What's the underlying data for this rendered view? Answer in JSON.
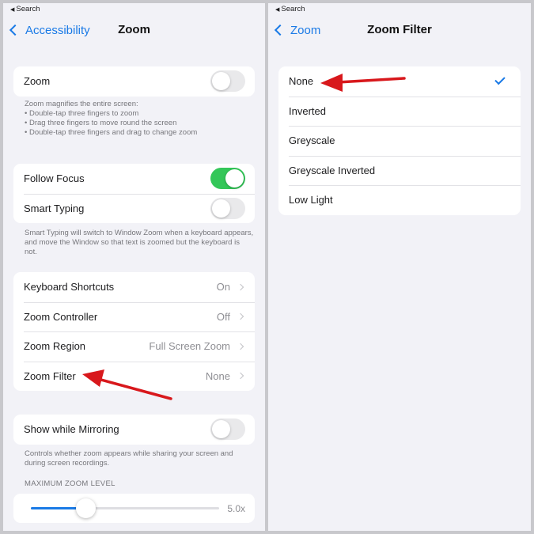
{
  "left": {
    "status": "Search",
    "back_label": "Accessibility",
    "title": "Zoom",
    "zoom_group": {
      "label": "Zoom",
      "on": false
    },
    "zoom_footer": {
      "intro": "Zoom magnifies the entire screen:",
      "bullets": [
        "Double-tap three fingers to zoom",
        "Drag three fingers to move round the screen",
        "Double-tap three fingers and drag to change zoom"
      ]
    },
    "focus_group": [
      {
        "label": "Follow Focus",
        "on": true
      },
      {
        "label": "Smart Typing",
        "on": false
      }
    ],
    "focus_footer": "Smart Typing will switch to Window Zoom when a keyboard appears, and move the Window so that text is zoomed but the keyboard is not.",
    "settings_group": [
      {
        "label": "Keyboard Shortcuts",
        "value": "On"
      },
      {
        "label": "Zoom Controller",
        "value": "Off"
      },
      {
        "label": "Zoom Region",
        "value": "Full Screen Zoom"
      },
      {
        "label": "Zoom Filter",
        "value": "None"
      }
    ],
    "mirroring_group": {
      "label": "Show while Mirroring",
      "on": false
    },
    "mirroring_footer": "Controls whether zoom appears while sharing your screen and during screen recordings.",
    "max_zoom": {
      "header": "MAXIMUM ZOOM LEVEL",
      "value_label": "5.0x",
      "fraction": 0.29
    }
  },
  "right": {
    "status": "Search",
    "back_label": "Zoom",
    "title": "Zoom Filter",
    "options": [
      {
        "label": "None",
        "selected": true
      },
      {
        "label": "Inverted",
        "selected": false
      },
      {
        "label": "Greyscale",
        "selected": false
      },
      {
        "label": "Greyscale Inverted",
        "selected": false
      },
      {
        "label": "Low Light",
        "selected": false
      }
    ]
  },
  "colors": {
    "accent": "#1a7ae6",
    "toggle_on": "#34c759",
    "annotation_arrow": "#d8181c"
  }
}
